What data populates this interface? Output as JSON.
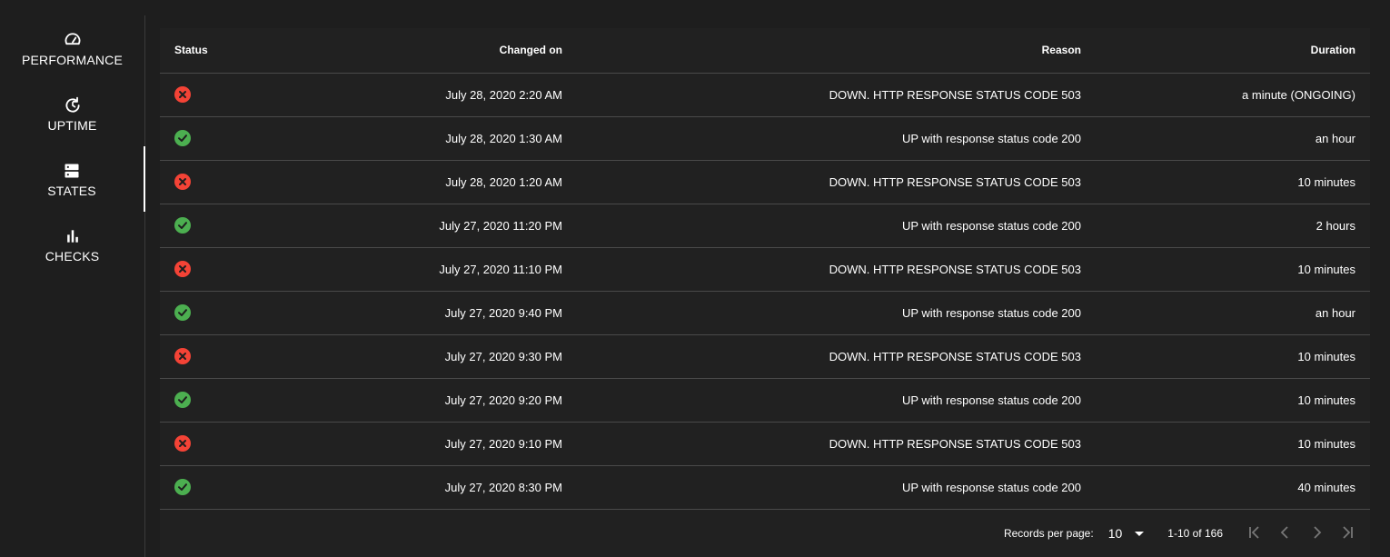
{
  "sidebar": {
    "items": [
      {
        "label": "PERFORMANCE",
        "icon": "speedometer-icon"
      },
      {
        "label": "UPTIME",
        "icon": "clock-refresh-icon"
      },
      {
        "label": "STATES",
        "icon": "server-icon",
        "active": true
      },
      {
        "label": "CHECKS",
        "icon": "bar-chart-icon"
      }
    ]
  },
  "table": {
    "headers": {
      "status": "Status",
      "changed_on": "Changed on",
      "reason": "Reason",
      "duration": "Duration"
    },
    "rows": [
      {
        "status": "down",
        "changed_on": "July 28, 2020 2:20 AM",
        "reason": "DOWN. HTTP RESPONSE STATUS CODE 503",
        "duration": "a minute (ONGOING)"
      },
      {
        "status": "up",
        "changed_on": "July 28, 2020 1:30 AM",
        "reason": "UP with response status code 200",
        "duration": "an hour"
      },
      {
        "status": "down",
        "changed_on": "July 28, 2020 1:20 AM",
        "reason": "DOWN. HTTP RESPONSE STATUS CODE 503",
        "duration": "10 minutes"
      },
      {
        "status": "up",
        "changed_on": "July 27, 2020 11:20 PM",
        "reason": "UP with response status code 200",
        "duration": "2 hours"
      },
      {
        "status": "down",
        "changed_on": "July 27, 2020 11:10 PM",
        "reason": "DOWN. HTTP RESPONSE STATUS CODE 503",
        "duration": "10 minutes"
      },
      {
        "status": "up",
        "changed_on": "July 27, 2020 9:40 PM",
        "reason": "UP with response status code 200",
        "duration": "an hour"
      },
      {
        "status": "down",
        "changed_on": "July 27, 2020 9:30 PM",
        "reason": "DOWN. HTTP RESPONSE STATUS CODE 503",
        "duration": "10 minutes"
      },
      {
        "status": "up",
        "changed_on": "July 27, 2020 9:20 PM",
        "reason": "UP with response status code 200",
        "duration": "10 minutes"
      },
      {
        "status": "down",
        "changed_on": "July 27, 2020 9:10 PM",
        "reason": "DOWN. HTTP RESPONSE STATUS CODE 503",
        "duration": "10 minutes"
      },
      {
        "status": "up",
        "changed_on": "July 27, 2020 8:30 PM",
        "reason": "UP with response status code 200",
        "duration": "40 minutes"
      }
    ]
  },
  "pagination": {
    "records_per_page_label": "Records per page:",
    "records_per_page_value": "10",
    "range": "1-10 of 166"
  },
  "colors": {
    "up": "#4caf50",
    "down": "#f44336",
    "background": "#1e1e1e",
    "panel": "#212121"
  }
}
